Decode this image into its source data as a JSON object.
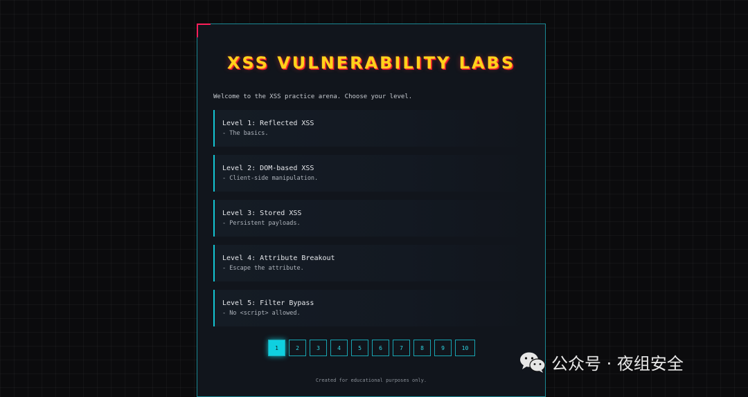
{
  "header": {
    "title": "XSS VULNERABILITY LABS"
  },
  "intro": "Welcome to the XSS practice arena. Choose your level.",
  "levels": [
    {
      "title": "Level 1: Reflected XSS",
      "desc": "- The basics."
    },
    {
      "title": "Level 2: DOM-based XSS",
      "desc": "- Client-side manipulation."
    },
    {
      "title": "Level 3: Stored XSS",
      "desc": "- Persistent payloads."
    },
    {
      "title": "Level 4: Attribute Breakout",
      "desc": "- Escape the attribute."
    },
    {
      "title": "Level 5: Filter Bypass",
      "desc": "- No <script> allowed."
    }
  ],
  "pagination": {
    "pages": [
      "1",
      "2",
      "3",
      "4",
      "5",
      "6",
      "7",
      "8",
      "9",
      "10"
    ],
    "current": "1"
  },
  "footer": "Created for educational purposes only.",
  "watermark": {
    "text": "公众号 · 夜组安全",
    "icon": "wechat-icon"
  },
  "colors": {
    "accent": "#14c6d4",
    "corner": "#ff1f5a",
    "title": "#ffd21a",
    "title_shadow": "#c4161f"
  }
}
